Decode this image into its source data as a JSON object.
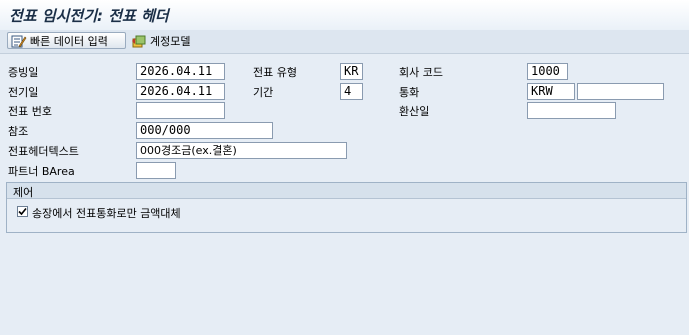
{
  "window": {
    "title": "전표 임시전기: 전표 헤더"
  },
  "toolbar": {
    "quick_entry_label": "빠른 데이터 입력",
    "account_model_label": "계정모델"
  },
  "form": {
    "doc_date": {
      "label": "증빙일",
      "value": "2026.04.11"
    },
    "doc_type": {
      "label": "전표 유형",
      "value": "KR"
    },
    "company_code": {
      "label": "회사 코드",
      "value": "1000"
    },
    "posting_date": {
      "label": "전기일",
      "value": "2026.04.11"
    },
    "period": {
      "label": "기간",
      "value": "4"
    },
    "currency": {
      "label": "통화",
      "value": "KRW",
      "rate_value": ""
    },
    "doc_number": {
      "label": "전표 번호",
      "value": ""
    },
    "translation_date": {
      "label": "환산일",
      "value": ""
    },
    "reference": {
      "label": "참조",
      "value": "000/000"
    },
    "header_text": {
      "label": "전표헤더텍스트",
      "value": "000경조금(ex.결혼)"
    },
    "partner_barea": {
      "label": "파트너 BArea",
      "value": ""
    }
  },
  "control": {
    "title": "제어",
    "checkbox_label": "송장에서 전표통화로만 금액대체",
    "checked": true
  }
}
